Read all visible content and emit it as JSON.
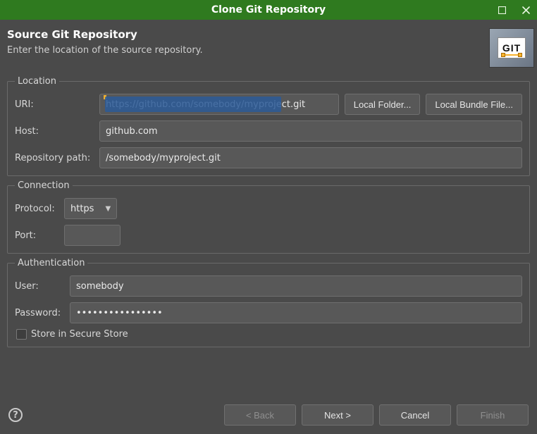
{
  "window": {
    "title": "Clone Git Repository"
  },
  "header": {
    "title": "Source Git Repository",
    "subtitle": "Enter the location of the source repository.",
    "icon_label": "GIT"
  },
  "location": {
    "legend": "Location",
    "uri_label": "URI:",
    "uri_value": "https://github.com/somebody/myproject.git",
    "uri_selected_part": "https://github.com/somebody/myproje",
    "local_folder_btn": "Local Folder...",
    "local_bundle_btn": "Local Bundle File...",
    "host_label": "Host:",
    "host_value": "github.com",
    "repo_path_label": "Repository path:",
    "repo_path_value": "/somebody/myproject.git"
  },
  "connection": {
    "legend": "Connection",
    "protocol_label": "Protocol:",
    "protocol_value": "https",
    "port_label": "Port:",
    "port_value": ""
  },
  "authentication": {
    "legend": "Authentication",
    "user_label": "User:",
    "user_value": "somebody",
    "password_label": "Password:",
    "password_value": "abcdefghijklmopq",
    "store_checkbox_label": "Store in Secure Store",
    "store_checked": false
  },
  "footer": {
    "help": "?",
    "back": "< Back",
    "next": "Next >",
    "cancel": "Cancel",
    "finish": "Finish"
  }
}
